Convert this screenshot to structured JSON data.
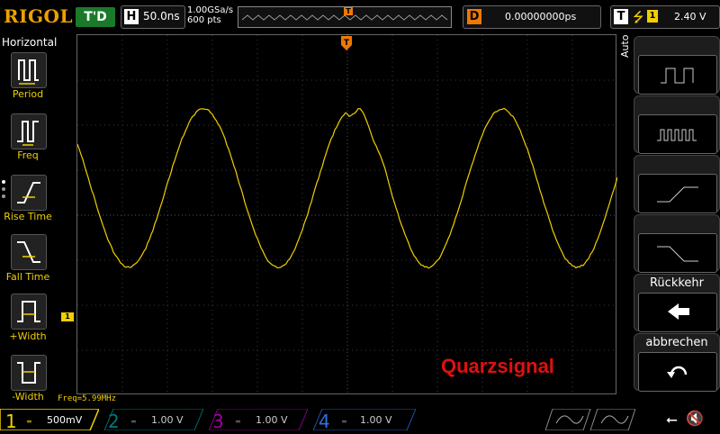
{
  "top": {
    "logo": "RIGOL",
    "trigger_status": "T'D",
    "horizontal_key": "H",
    "timebase": "50.0ns",
    "sample_rate": "1.00GSa/s",
    "memory_depth": "600 pts",
    "delay_key": "D",
    "delay_value": "0.00000000ps",
    "trigger_key": "T",
    "trigger_channel": "1",
    "trigger_level": "2.40 V"
  },
  "left_menu": {
    "title": "Horizontal",
    "items": [
      {
        "label": "Period"
      },
      {
        "label": "Freq"
      },
      {
        "label": "Rise Time"
      },
      {
        "label": "Fall Time"
      },
      {
        "label": "+Width"
      },
      {
        "label": "-Width"
      }
    ]
  },
  "right_menu": {
    "auto_label": "Auto",
    "back_label": "Rückkehr",
    "cancel_label": "abbrechen"
  },
  "screen": {
    "freq_readout": "Freq=5.99MHz",
    "annotation": "Quarzsignal",
    "ch1_marker": "1",
    "trigger_marker": "T"
  },
  "bottom": {
    "channels": [
      {
        "num": "1",
        "scale": "500mV",
        "color": "#f0d000",
        "active": true
      },
      {
        "num": "2",
        "scale": "1.00 V",
        "color": "#00a0a0",
        "active": false
      },
      {
        "num": "3",
        "scale": "1.00 V",
        "color": "#c000c0",
        "active": false
      },
      {
        "num": "4",
        "scale": "1.00 V",
        "color": "#2060d0",
        "active": false
      }
    ]
  },
  "colors": {
    "ch1": "#f0d000",
    "accent_orange": "#f07800",
    "annotation_red": "#e01010"
  }
}
